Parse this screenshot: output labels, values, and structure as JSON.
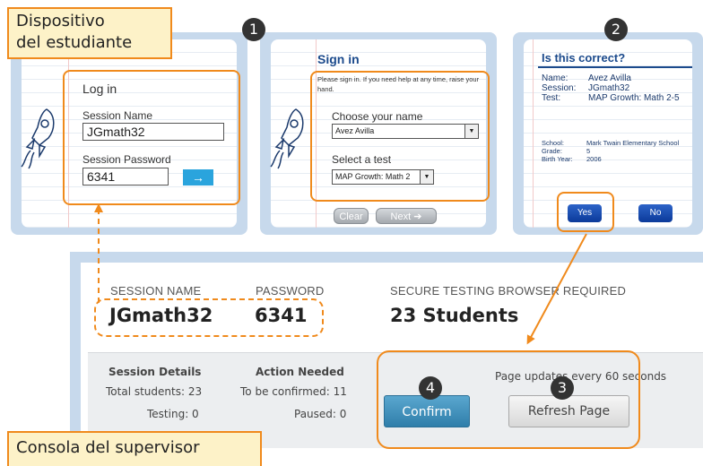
{
  "captions": {
    "student_device": "Dispositivo\ndel estudiante",
    "proctor_console": "Consola del supervisor"
  },
  "badges": [
    "1",
    "2",
    "3",
    "4"
  ],
  "login": {
    "title": "Log in",
    "session_name_label": "Session Name",
    "session_name_value": "JGmath32",
    "password_label": "Session Password",
    "password_value": "6341",
    "go_icon": "arrow-right-icon"
  },
  "signin": {
    "title": "Sign in",
    "help_text": "Please sign in. If you need help at any time, raise your hand.",
    "name_label": "Choose your name",
    "name_value": "Avez Avilla",
    "test_label": "Select a test",
    "test_value": "MAP Growth: Math 2",
    "clear_label": "Clear",
    "next_label": "Next"
  },
  "confirm": {
    "title": "Is this correct?",
    "name_label": "Name:",
    "name_value": "Avez Avilla",
    "session_label": "Session:",
    "session_value": "JGmath32",
    "test_label": "Test:",
    "test_value": "MAP Growth: Math 2-5",
    "school_label": "School:",
    "school_value": "Mark Twain Elementary School",
    "grade_label": "Grade:",
    "grade_value": "5",
    "birth_label": "Birth Year:",
    "birth_value": "2006",
    "yes_label": "Yes",
    "no_label": "No"
  },
  "console": {
    "session_name_label": "SESSION NAME",
    "session_name_value": "JGmath32",
    "password_label": "PASSWORD",
    "password_value": "6341",
    "secure_label": "SECURE TESTING BROWSER REQUIRED",
    "students_value": "23 Students",
    "details_heading": "Session Details",
    "total_students": "Total students: 23",
    "testing": "Testing: 0",
    "action_heading": "Action Needed",
    "to_be_confirmed": "To be confirmed: 11",
    "paused": "Paused: 0",
    "refresh_note": "Page updates every 60 seconds",
    "confirm_label": "Confirm",
    "refresh_label": "Refresh Page"
  },
  "colors": {
    "highlight": "#f08a1c",
    "caption_bg": "#fdf2c8",
    "panel_frame": "#c7d9ec",
    "signin_blue": "#1b4a8c",
    "go_button": "#2aa4dd",
    "confirm_button": "#3f92be"
  }
}
